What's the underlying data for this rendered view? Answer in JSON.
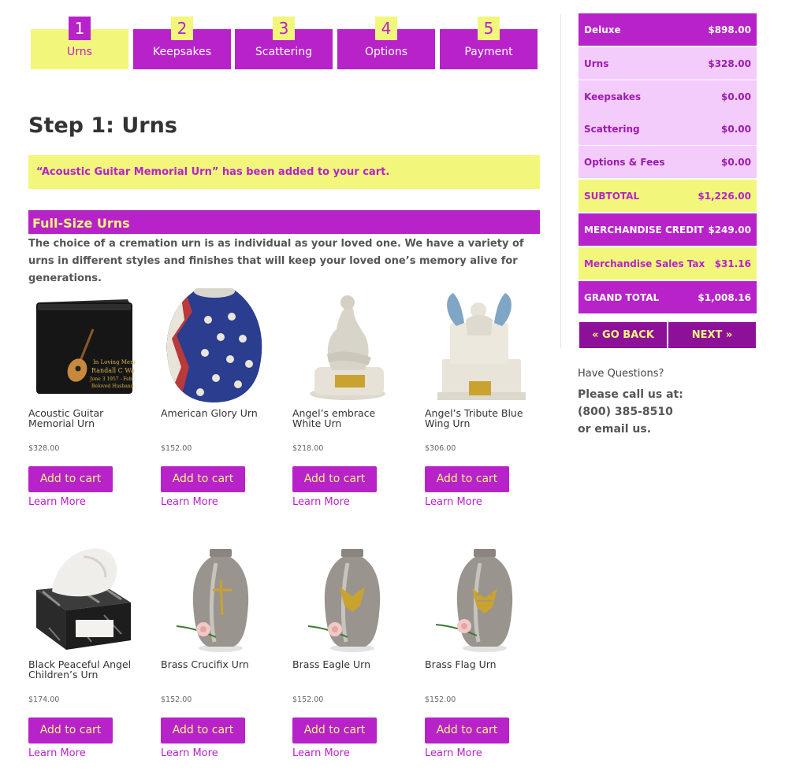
{
  "steps": [
    {
      "num": "1",
      "label": "Urns"
    },
    {
      "num": "2",
      "label": "Keepsakes"
    },
    {
      "num": "3",
      "label": "Scattering"
    },
    {
      "num": "4",
      "label": "Options"
    },
    {
      "num": "5",
      "label": "Payment"
    }
  ],
  "page": {
    "title": "Step 1: Urns",
    "notice": "“Acoustic Guitar Memorial Urn” has been added to your cart.",
    "section_title": "Full-Size Urns",
    "intro": "The choice of a cremation urn is as individual as your loved one.  We have a variety of urns in different styles and finishes that will keep your loved one’s memory alive for generations."
  },
  "products": [
    {
      "name": "Acoustic Guitar Memorial Urn",
      "price": "$328.00",
      "button": "Add to cart",
      "learn": "Learn More",
      "icon": "black-box-urn-icon"
    },
    {
      "name": "American Glory Urn",
      "price": "$152.00",
      "button": "Add to cart",
      "learn": "Learn More",
      "icon": "flag-vase-urn-icon"
    },
    {
      "name": "Angel’s embrace White Urn",
      "price": "$218.00",
      "button": "Add to cart",
      "learn": "Learn More",
      "icon": "statue-urn-icon"
    },
    {
      "name": "Angel’s Tribute Blue Wing Urn",
      "price": "$306.00",
      "button": "Add to cart",
      "learn": "Learn More",
      "icon": "angel-urn-icon"
    },
    {
      "name": "Black Peaceful Angel Children’s Urn",
      "price": "$174.00",
      "button": "Add to cart",
      "learn": "Learn More",
      "icon": "marble-angel-urn-icon"
    },
    {
      "name": "Brass Crucifix Urn",
      "price": "$152.00",
      "button": "Add to cart",
      "learn": "Learn More",
      "icon": "pewter-vase-urn-icon"
    },
    {
      "name": "Brass Eagle Urn",
      "price": "$152.00",
      "button": "Add to cart",
      "learn": "Learn More",
      "icon": "pewter-vase-urn-icon"
    },
    {
      "name": "Brass Flag Urn",
      "price": "$152.00",
      "button": "Add to cart",
      "learn": "Learn More",
      "icon": "pewter-vase-urn-icon"
    }
  ],
  "cart": [
    {
      "label": "Deluxe",
      "value": "$898.00",
      "style": "purple"
    },
    {
      "label": "Urns",
      "value": "$328.00",
      "style": "pink"
    },
    {
      "label": "Keepsakes",
      "value": "$0.00",
      "style": "pink"
    },
    {
      "label": "Scattering",
      "value": "$0.00",
      "style": "pink"
    },
    {
      "label": "Options & Fees",
      "value": "$0.00",
      "style": "pink"
    },
    {
      "label": "SUBTOTAL",
      "value": "$1,226.00",
      "style": "yellow"
    },
    {
      "label": "MERCHANDISE CREDIT",
      "value": "$249.00",
      "style": "purple"
    },
    {
      "label": "Merchandise Sales Tax",
      "value": "$31.16",
      "style": "yellow"
    },
    {
      "label": "GRAND TOTAL",
      "value": "$1,008.16",
      "style": "purple"
    }
  ],
  "nav": {
    "back": "« GO BACK",
    "next": "NEXT »"
  },
  "help": {
    "question": "Have Questions?",
    "line1": "Please call us at:",
    "phone": "(800) 385-8510",
    "line3": "or email us."
  },
  "colors": {
    "purple": "#b722c9",
    "yellow": "#f2f77c",
    "pink": "#f4ccfb",
    "dark_purple": "#8c1198"
  }
}
